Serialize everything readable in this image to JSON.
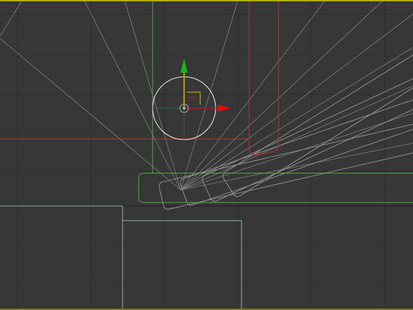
{
  "viewport": {
    "name": "viewport-top",
    "background": "#373737",
    "grid_color": "#2b2b2b",
    "active_border_color": "#b5b000"
  },
  "colors": {
    "green_object": "#4fb03c",
    "red_object": "#c0302a",
    "teal_object": "#8fb5b0",
    "camera_frustum": "#8a8a8a",
    "gizmo_x": "#e01010",
    "gizmo_y": "#18b818",
    "gizmo_z": "#d8c000",
    "gizmo_circle": "#e6e6e6"
  },
  "objects": [
    {
      "name": "green-wall",
      "type": "wireframe",
      "color": "green"
    },
    {
      "name": "green-shelf",
      "type": "wireframe",
      "color": "green"
    },
    {
      "name": "red-wall",
      "type": "wireframe",
      "color": "red"
    },
    {
      "name": "teal-box-left",
      "type": "wireframe",
      "color": "teal"
    },
    {
      "name": "teal-box-right",
      "type": "wireframe",
      "color": "teal"
    },
    {
      "name": "rotating-plank-copies",
      "type": "wireframe",
      "color": "gray",
      "count": 4
    }
  ],
  "gizmo": {
    "type": "move-rotate-gizmo",
    "axes": [
      "x-axis",
      "y-axis",
      "z-axis"
    ]
  }
}
